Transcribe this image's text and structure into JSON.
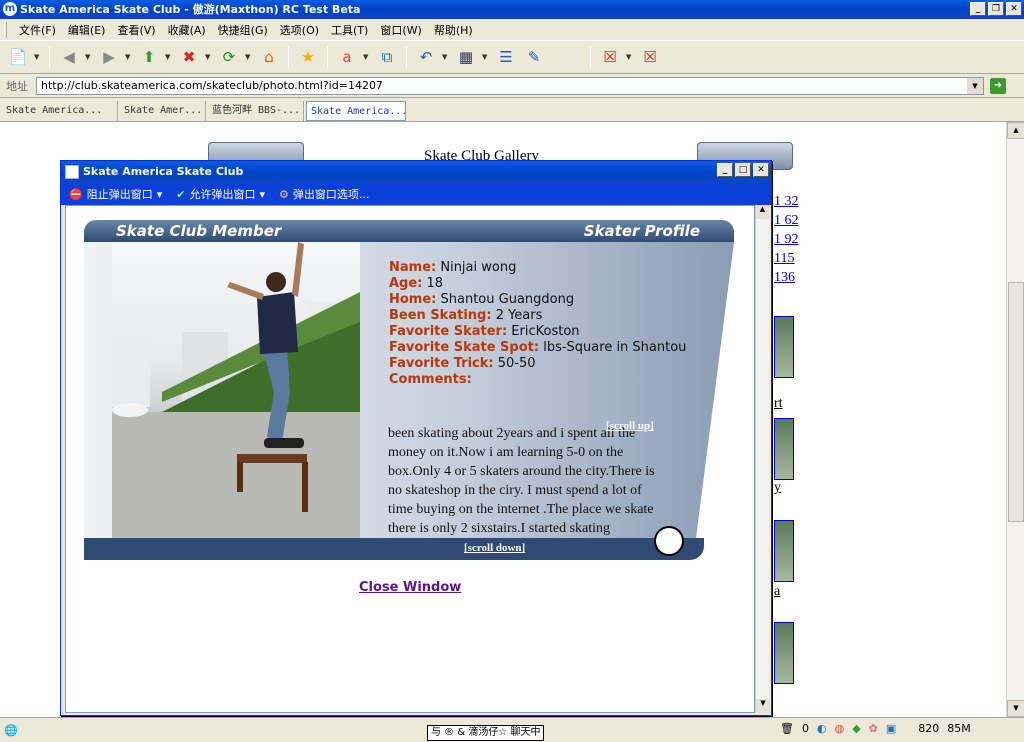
{
  "window": {
    "title": "Skate America Skate Club - 傲游(Maxthon) RC Test Beta"
  },
  "menu": [
    "文件(F)",
    "编辑(E)",
    "查看(V)",
    "收藏(A)",
    "快捷组(G)",
    "选项(O)",
    "工具(T)",
    "窗口(W)",
    "帮助(H)"
  ],
  "address": {
    "label": "地址",
    "url": "http://club.skateamerica.com/skateclub/photo.html?id=14207"
  },
  "tabs": [
    "Skate America...",
    "Skate Amer...",
    "蓝色河畔 BBS-...",
    "Skate America..."
  ],
  "page": {
    "gallery_title": "Skate Club Gallery",
    "page_links": [
      "1 32",
      "1 62",
      "1 92",
      "115",
      "136"
    ],
    "side_texts": [
      "rt",
      "y",
      "a"
    ]
  },
  "popup": {
    "title": "Skate America Skate Club",
    "bar": {
      "block": "阻止弹出窗口",
      "allow": "允许弹出窗口",
      "options": "弹出窗口选项..."
    },
    "card": {
      "header_left": "Skate Club Member",
      "header_right": "Skater Profile",
      "fields": [
        {
          "k": "Name:",
          "v": "Ninjai wong"
        },
        {
          "k": "Age:",
          "v": "18"
        },
        {
          "k": "Home:",
          "v": "Shantou Guangdong"
        },
        {
          "k": "Been Skating:",
          "v": "2 Years"
        },
        {
          "k": "Favorite Skater:",
          "v": "EricKoston"
        },
        {
          "k": "Favorite Skate Spot:",
          "v": "lbs-Square in Shantou"
        },
        {
          "k": "Favorite Trick:",
          "v": "50-50"
        },
        {
          "k": "Comments:",
          "v": ""
        }
      ],
      "comment": "been skating about 2years and i spent all the money on it.Now i am learning 5-0 on the box.Only 4 or 5 skaters around the city.There is no skateshop in the ciry. I must spend a lot of time buying on the internet .The place we skate there is only 2 sixstairs.I started skating",
      "scroll_up": "[scroll up]",
      "scroll_down": "[scroll down]"
    },
    "close_window": "Close Window"
  },
  "status": {
    "chat": "与 ® & 滴汤仔☆ 聊天中",
    "trash_count": "0",
    "memory": "820",
    "mem_unit": "85M"
  }
}
